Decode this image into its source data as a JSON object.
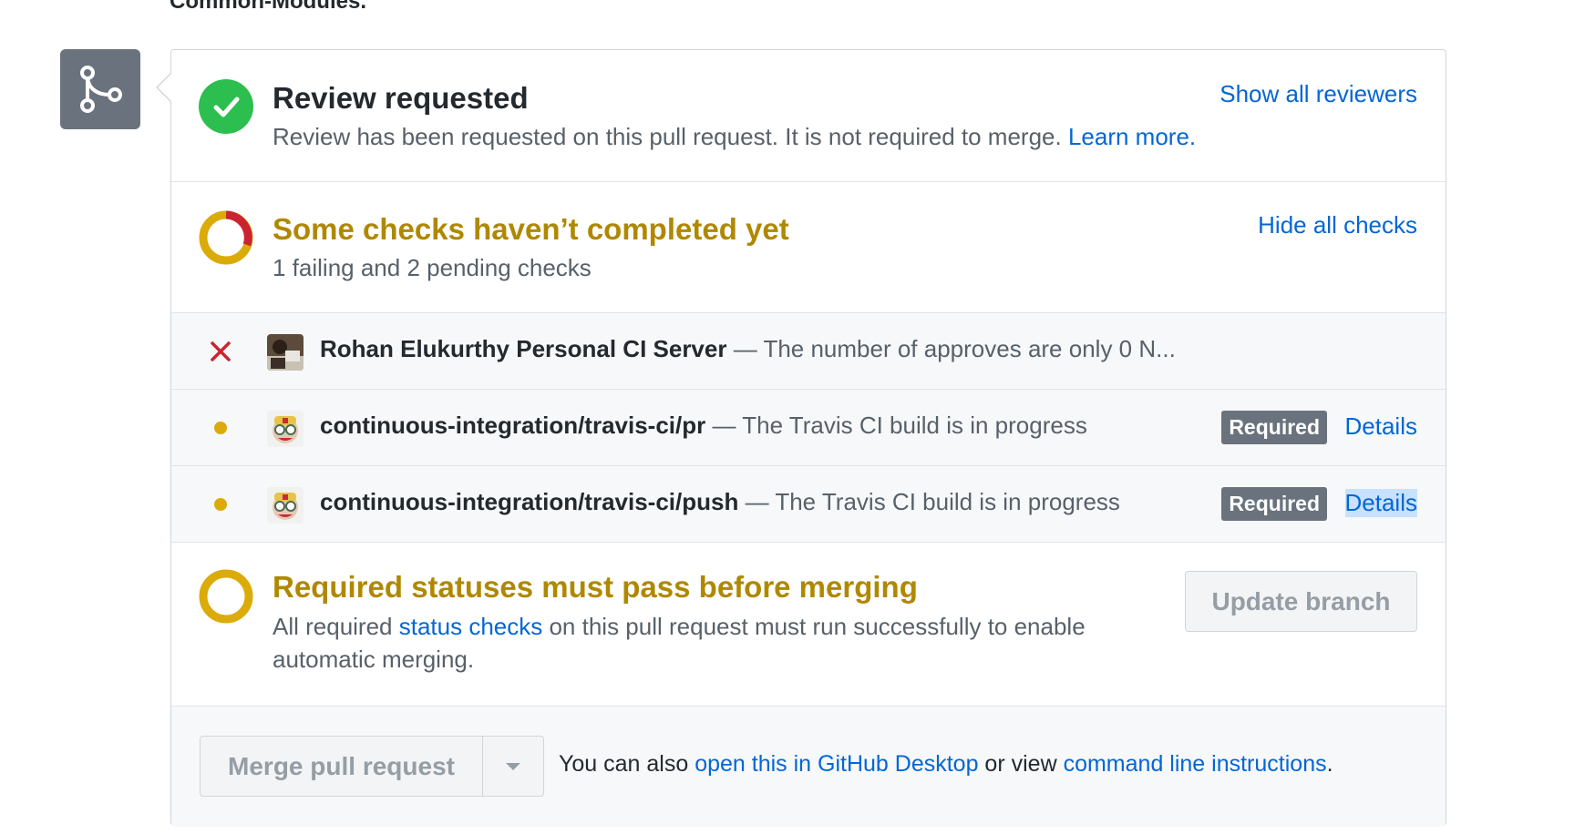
{
  "top_text": "Common-Modules.",
  "review": {
    "title": "Review requested",
    "text": "Review has been requested on this pull request. It is not required to merge.",
    "learn_more": "Learn more.",
    "show_reviewers": "Show all reviewers"
  },
  "checks": {
    "title": "Some checks haven’t completed yet",
    "summary": "1 failing and 2 pending checks",
    "hide_link": "Hide all checks",
    "items": [
      {
        "state": "failing",
        "context": "Rohan Elukurthy Personal CI Server",
        "description": " — The number of approves are only 0 N..."
      },
      {
        "state": "pending",
        "context": "continuous-integration/travis-ci/pr",
        "description": " — The Travis CI build is in progress",
        "badge": "Required",
        "details": "Details"
      },
      {
        "state": "pending",
        "context": "continuous-integration/travis-ci/push",
        "description": " — The Travis CI build is in progress",
        "badge": "Required",
        "details": "Details"
      }
    ]
  },
  "required": {
    "title": "Required statuses must pass before merging",
    "text_before": "All required ",
    "status_checks_link": "status checks",
    "text_after": " on this pull request must run successfully to enable",
    "text_line2": "automatic merging.",
    "update_button": "Update branch"
  },
  "merge": {
    "button": "Merge pull request",
    "note_prefix": "You can also ",
    "desktop_link": "open this in GitHub Desktop",
    "note_middle": " or view ",
    "cli_link": "command line instructions",
    "note_suffix": "."
  },
  "colors": {
    "success": "#2cbe4e",
    "failure": "#cb2431",
    "pending": "#dbab09",
    "pending_text": "#b08800",
    "link": "#0366d6",
    "badge": "#6a737d"
  }
}
